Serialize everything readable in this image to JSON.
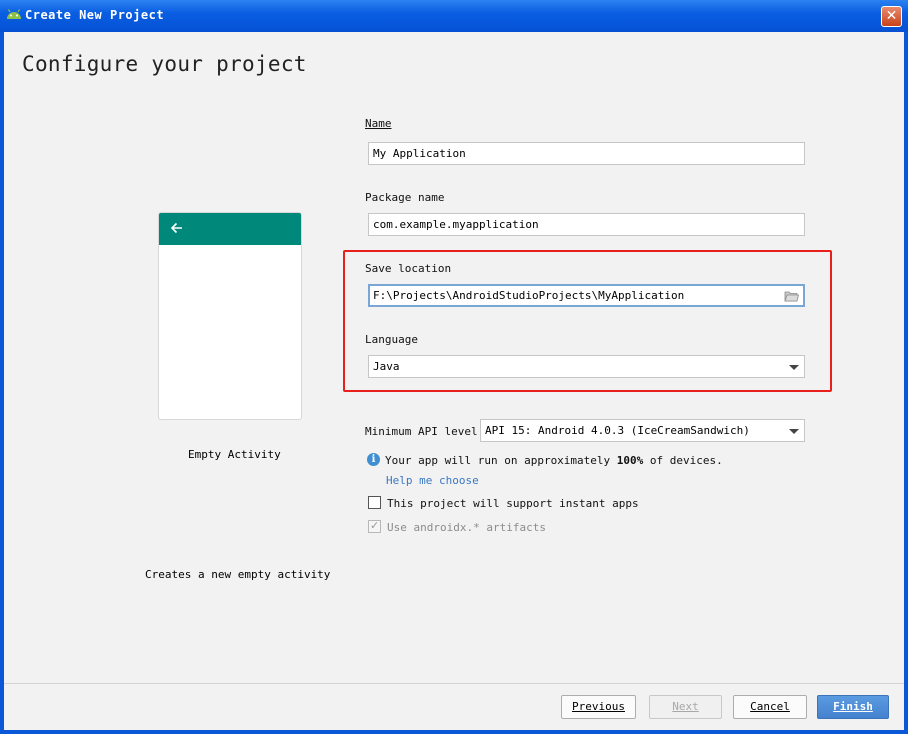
{
  "window": {
    "title": "Create New Project",
    "close_glyph": "✕"
  },
  "heading": "Configure your project",
  "template": {
    "name": "Empty Activity",
    "description": "Creates a new empty activity",
    "toolbar_color": "#00897B",
    "back_icon": "arrow-left-icon"
  },
  "form": {
    "name": {
      "label": "Name",
      "value": "My Application"
    },
    "package": {
      "label": "Package name",
      "value": "com.example.myapplication"
    },
    "save_location": {
      "label": "Save location",
      "value": "F:\\Projects\\AndroidStudioProjects\\MyApplication",
      "icon": "folder-icon"
    },
    "language": {
      "label": "Language",
      "value": "Java"
    },
    "min_api": {
      "label": "Minimum API level",
      "value": "API 15: Android 4.0.3 (IceCreamSandwich)"
    },
    "api_info": {
      "prefix": "Your app will run on approximately ",
      "percent": "100%",
      "suffix": " of devices."
    },
    "help_link": "Help me choose",
    "instant_apps": {
      "label": "This project will support instant apps",
      "checked": false
    },
    "androidx": {
      "label": "Use androidx.* artifacts",
      "checked": true,
      "enabled": false
    }
  },
  "highlight_color": "#E8201C",
  "buttons": {
    "previous": "Previous",
    "next": "Next",
    "cancel": "Cancel",
    "finish": "Finish"
  }
}
